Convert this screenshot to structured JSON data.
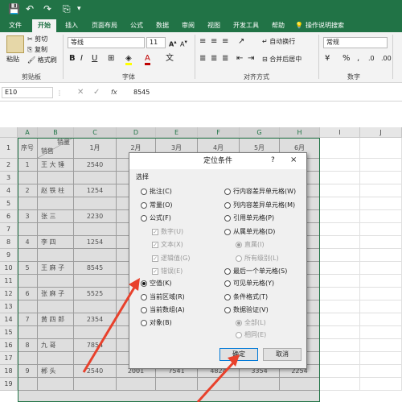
{
  "quick_access": {
    "save": "💾",
    "undo": "↶",
    "redo": "↷",
    "touch": "⎘",
    "more": "▾"
  },
  "tabs": [
    "文件",
    "开始",
    "插入",
    "页面布局",
    "公式",
    "数据",
    "审阅",
    "视图",
    "开发工具",
    "帮助",
    "操作说明搜索"
  ],
  "ribbon": {
    "paste": "粘贴",
    "cut": "剪切",
    "copy": "复制",
    "format_painter": "格式刷",
    "font_name": "等线",
    "font_size": "11",
    "wrap_text": "自动换行",
    "merge_center": "合并后居中",
    "number_format": "常规",
    "percent": "%",
    "comma": ",",
    "groups": [
      "剪贴板",
      "字体",
      "对齐方式",
      "数字"
    ]
  },
  "formula_bar": {
    "name_box": "E10",
    "fx": "fx",
    "value": "8545"
  },
  "sheet": {
    "columns": [
      "A",
      "B",
      "C",
      "D",
      "E",
      "F",
      "G",
      "H",
      "I",
      "J"
    ],
    "header": {
      "a": "序号",
      "b_top": "销量",
      "b_bottom": "销售",
      "months": [
        "1月",
        "2月",
        "3月",
        "4月",
        "5月",
        "6月"
      ]
    },
    "rows": [
      {
        "num": "1",
        "name": "",
        "c": "",
        "h": ""
      },
      {
        "num": "2",
        "a": "1",
        "name": "王 大 锤",
        "c": "2540",
        "h": ""
      },
      {
        "num": "3",
        "a": "",
        "name": "",
        "c": "",
        "h": ""
      },
      {
        "num": "4",
        "a": "2",
        "name": "赵 铁 柱",
        "c": "1254",
        "h": ""
      },
      {
        "num": "5",
        "a": "",
        "name": "",
        "c": "",
        "h": ""
      },
      {
        "num": "6",
        "a": "3",
        "name": "张    三",
        "c": "2230",
        "h": ""
      },
      {
        "num": "7",
        "a": "",
        "name": "",
        "c": "",
        "h": ""
      },
      {
        "num": "8",
        "a": "4",
        "name": "李    四",
        "c": "1254",
        "h": ""
      },
      {
        "num": "9",
        "a": "",
        "name": "",
        "c": "",
        "h": ""
      },
      {
        "num": "10",
        "a": "5",
        "name": "王 麻 子",
        "c": "8545",
        "h": ""
      },
      {
        "num": "11",
        "a": "",
        "name": "",
        "c": "",
        "h": ""
      },
      {
        "num": "12",
        "a": "6",
        "name": "张 麻 子",
        "c": "5525",
        "h": ""
      },
      {
        "num": "13",
        "a": "",
        "name": "",
        "c": "",
        "h": ""
      },
      {
        "num": "14",
        "a": "7",
        "name": "黄 四 郎",
        "c": "2354",
        "h": ""
      },
      {
        "num": "15",
        "a": "",
        "name": "",
        "c": "",
        "h": ""
      },
      {
        "num": "16",
        "a": "8",
        "name": "九    哥",
        "c": "7854",
        "h": ""
      },
      {
        "num": "17",
        "a": "",
        "name": "",
        "c": "",
        "h": ""
      },
      {
        "num": "18",
        "a": "9",
        "name": "郴    头",
        "c": "2540",
        "d": "2001",
        "e": "7541",
        "f": "4824",
        "g": "3354",
        "h": "2254"
      },
      {
        "num": "19",
        "a": "",
        "name": "",
        "c": "",
        "h": ""
      }
    ]
  },
  "dialog": {
    "title": "定位条件",
    "help": "?",
    "close": "×",
    "section": "选择",
    "left": [
      {
        "label": "批注(C)",
        "type": "radio",
        "on": false,
        "disabled": false
      },
      {
        "label": "常量(O)",
        "type": "radio",
        "on": false,
        "disabled": false
      },
      {
        "label": "公式(F)",
        "type": "radio",
        "on": false,
        "disabled": false
      },
      {
        "label": "数字(U)",
        "type": "check",
        "on": true,
        "disabled": true
      },
      {
        "label": "文本(X)",
        "type": "check",
        "on": true,
        "disabled": true
      },
      {
        "label": "逻辑值(G)",
        "type": "check",
        "on": true,
        "disabled": true
      },
      {
        "label": "错误(E)",
        "type": "check",
        "on": true,
        "disabled": true
      },
      {
        "label": "空值(K)",
        "type": "radio",
        "on": true,
        "disabled": false
      },
      {
        "label": "当前区域(R)",
        "type": "radio",
        "on": false,
        "disabled": false
      },
      {
        "label": "当前数组(A)",
        "type": "radio",
        "on": false,
        "disabled": false
      },
      {
        "label": "对象(B)",
        "type": "radio",
        "on": false,
        "disabled": false
      }
    ],
    "right": [
      {
        "label": "行内容差异单元格(W)",
        "type": "radio",
        "on": false,
        "disabled": false
      },
      {
        "label": "列内容差异单元格(M)",
        "type": "radio",
        "on": false,
        "disabled": false
      },
      {
        "label": "引用单元格(P)",
        "type": "radio",
        "on": false,
        "disabled": false
      },
      {
        "label": "从属单元格(D)",
        "type": "radio",
        "on": false,
        "disabled": false
      },
      {
        "label": "直属(I)",
        "type": "radio",
        "on": true,
        "disabled": true
      },
      {
        "label": "所有级别(L)",
        "type": "radio",
        "on": false,
        "disabled": true
      },
      {
        "label": "最后一个单元格(S)",
        "type": "radio",
        "on": false,
        "disabled": false
      },
      {
        "label": "可见单元格(Y)",
        "type": "radio",
        "on": false,
        "disabled": false
      },
      {
        "label": "条件格式(T)",
        "type": "radio",
        "on": false,
        "disabled": false
      },
      {
        "label": "数据验证(V)",
        "type": "radio",
        "on": false,
        "disabled": false
      },
      {
        "label": "全部(L)",
        "type": "radio",
        "on": true,
        "disabled": true
      },
      {
        "label": "相同(E)",
        "type": "radio",
        "on": false,
        "disabled": true
      }
    ],
    "ok": "确定",
    "cancel": "取消"
  },
  "colors": {
    "excel_green": "#217346",
    "arrow": "#e8412c"
  }
}
